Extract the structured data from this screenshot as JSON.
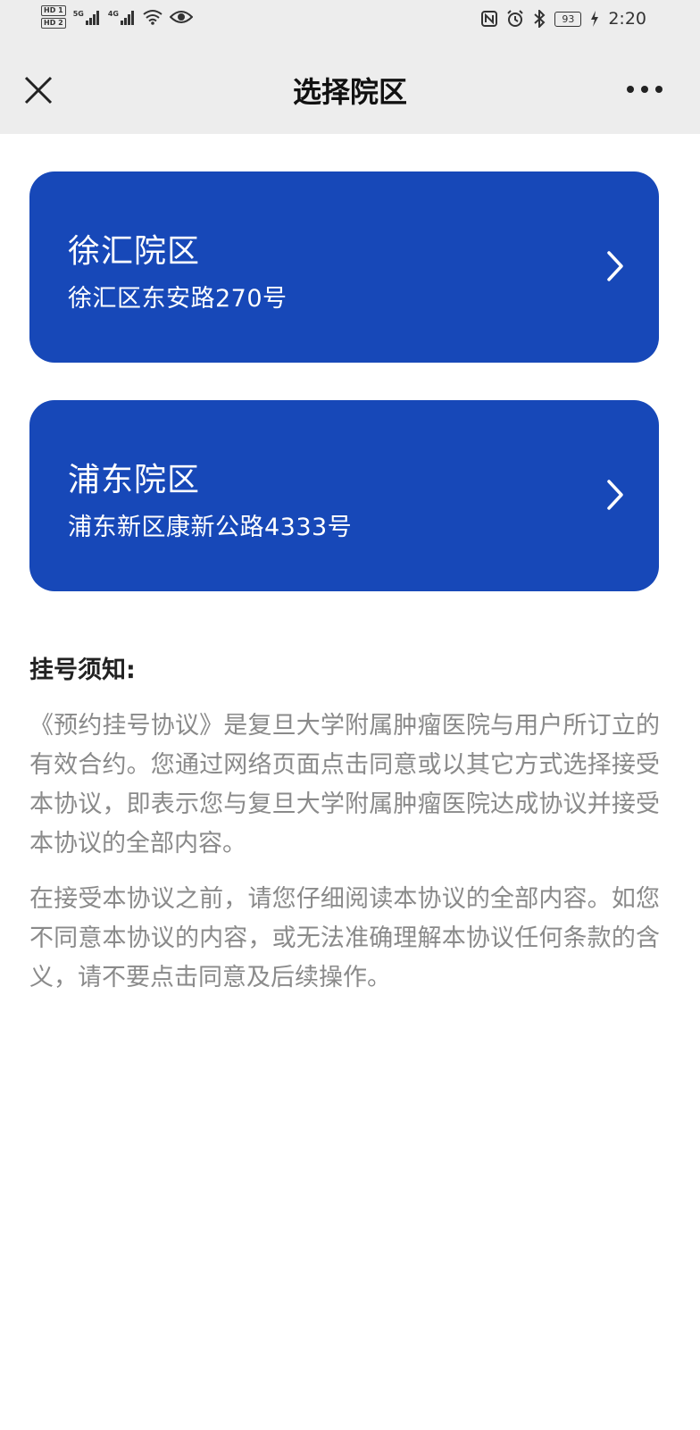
{
  "status_bar": {
    "hd1": "HD 1",
    "hd2": "HD 2",
    "net1": "5G",
    "net2": "4G",
    "battery": "93",
    "time": "2:20",
    "icons": [
      "signal-icon",
      "wifi-icon",
      "eye-icon",
      "nfc-icon",
      "alarm-icon",
      "bluetooth-icon",
      "battery-icon",
      "charging-icon"
    ]
  },
  "nav": {
    "title": "选择院区",
    "close_icon": "close-icon",
    "more_icon": "more-icon"
  },
  "campuses": [
    {
      "name": "徐汇院区",
      "address": "徐汇区东安路270号"
    },
    {
      "name": "浦东院区",
      "address": "浦东新区康新公路4333号"
    }
  ],
  "notice": {
    "title": "挂号须知:",
    "paragraphs": [
      "《预约挂号协议》是复旦大学附属肿瘤医院与用户所订立的有效合约。您通过网络页面点击同意或以其它方式选择接受本协议，即表示您与复旦大学附属肿瘤医院达成协议并接受本协议的全部内容。",
      "在接受本协议之前，请您仔细阅读本协议的全部内容。如您不同意本协议的内容，或无法准确理解本协议任何条款的含义，请不要点击同意及后续操作。"
    ]
  },
  "colors": {
    "card_bg": "#1748b8",
    "header_bg": "#ededed",
    "notice_text": "#8a8a8a"
  }
}
